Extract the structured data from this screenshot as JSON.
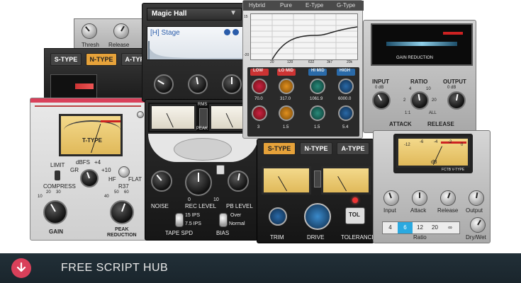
{
  "footer": {
    "title": "FREE SCRIPT HUB"
  },
  "topleft": {
    "thresh": "Thresh",
    "release": "Release"
  },
  "types": {
    "s": "S-TYPE",
    "n": "N-TYPE",
    "a": "A-TYPE"
  },
  "reverb": {
    "preset": "Magic Hall",
    "subpreset": "[H] Stage"
  },
  "eq": {
    "modes": [
      "Hybrid",
      "Pure",
      "E-Type",
      "G-Type"
    ],
    "selected_mode": "E-Type",
    "bands": [
      "LOW",
      "LO MID",
      "HI MID",
      "HIGH"
    ],
    "values_row1": [
      "70.0",
      "317.0",
      "1061.9",
      "6000.0"
    ],
    "values_row2": [
      "3",
      "1.5",
      "1.5",
      "5.4"
    ],
    "y_ticks": [
      "15",
      "10",
      "5",
      "0",
      "-5",
      "-10",
      "-15",
      "-20"
    ],
    "x_ticks": [
      "20",
      "120",
      "632",
      "3k7",
      "20k"
    ]
  },
  "gainred": {
    "label": "GAIN REDUCTION",
    "input": "INPUT",
    "ratio": "RATIO",
    "output": "OUTPUT",
    "attack": "ATTACK",
    "release": "RELEASE",
    "input_sub": "0 dB",
    "output_sub": "0 dB",
    "ratio_marks": [
      "4",
      "10",
      "2",
      "20",
      "1:1",
      "ALL"
    ]
  },
  "tube": {
    "meter_label": "T-TYPE",
    "limit": "LIMIT",
    "compress": "COMPRESS",
    "dbfs": "dBFS",
    "plus4": "+4",
    "gr": "GR",
    "plus10": "+10",
    "hf": "HF",
    "flat": "FLAT",
    "r37": "R37",
    "gain": "GAIN",
    "peak_reduction": "PEAK\nREDUCTION",
    "scale": [
      "10",
      "20",
      "30",
      "40",
      "50",
      "60"
    ]
  },
  "tape": {
    "noise": "NOISE",
    "rec_level": "REC LEVEL",
    "pb_level": "PB LEVEL",
    "tape_spd": "TAPE SPD",
    "bias": "BIAS",
    "ips15": "15 IPS",
    "ips7": "7.5 IPS",
    "over": "Over",
    "normal": "Normal",
    "rms": "RMS",
    "peak": "PEAK",
    "zero": "0",
    "ten": "10"
  },
  "ntype": {
    "trim": "TRIM",
    "drive": "DRIVE",
    "tolerance": "TOLERANCE",
    "tol": "TOL"
  },
  "comp": {
    "input": "Input",
    "attack": "Attack",
    "release": "Release",
    "output": "Output",
    "ratio_label": "Ratio",
    "drywet": "Dry/Wet",
    "ratios": [
      "4",
      "6",
      "12",
      "20",
      "∞"
    ],
    "selected_ratio": "6",
    "meter_unit": "dB",
    "brand": "FCTB V-TYPE",
    "meter_scale": [
      "-12",
      "-6",
      "-4",
      "-2",
      "0"
    ]
  },
  "colors": {
    "accent": "#d9405a",
    "footer_bg": "#1e2a33",
    "vu": "#f1d487",
    "ratio_sel": "#2aa9e0"
  }
}
